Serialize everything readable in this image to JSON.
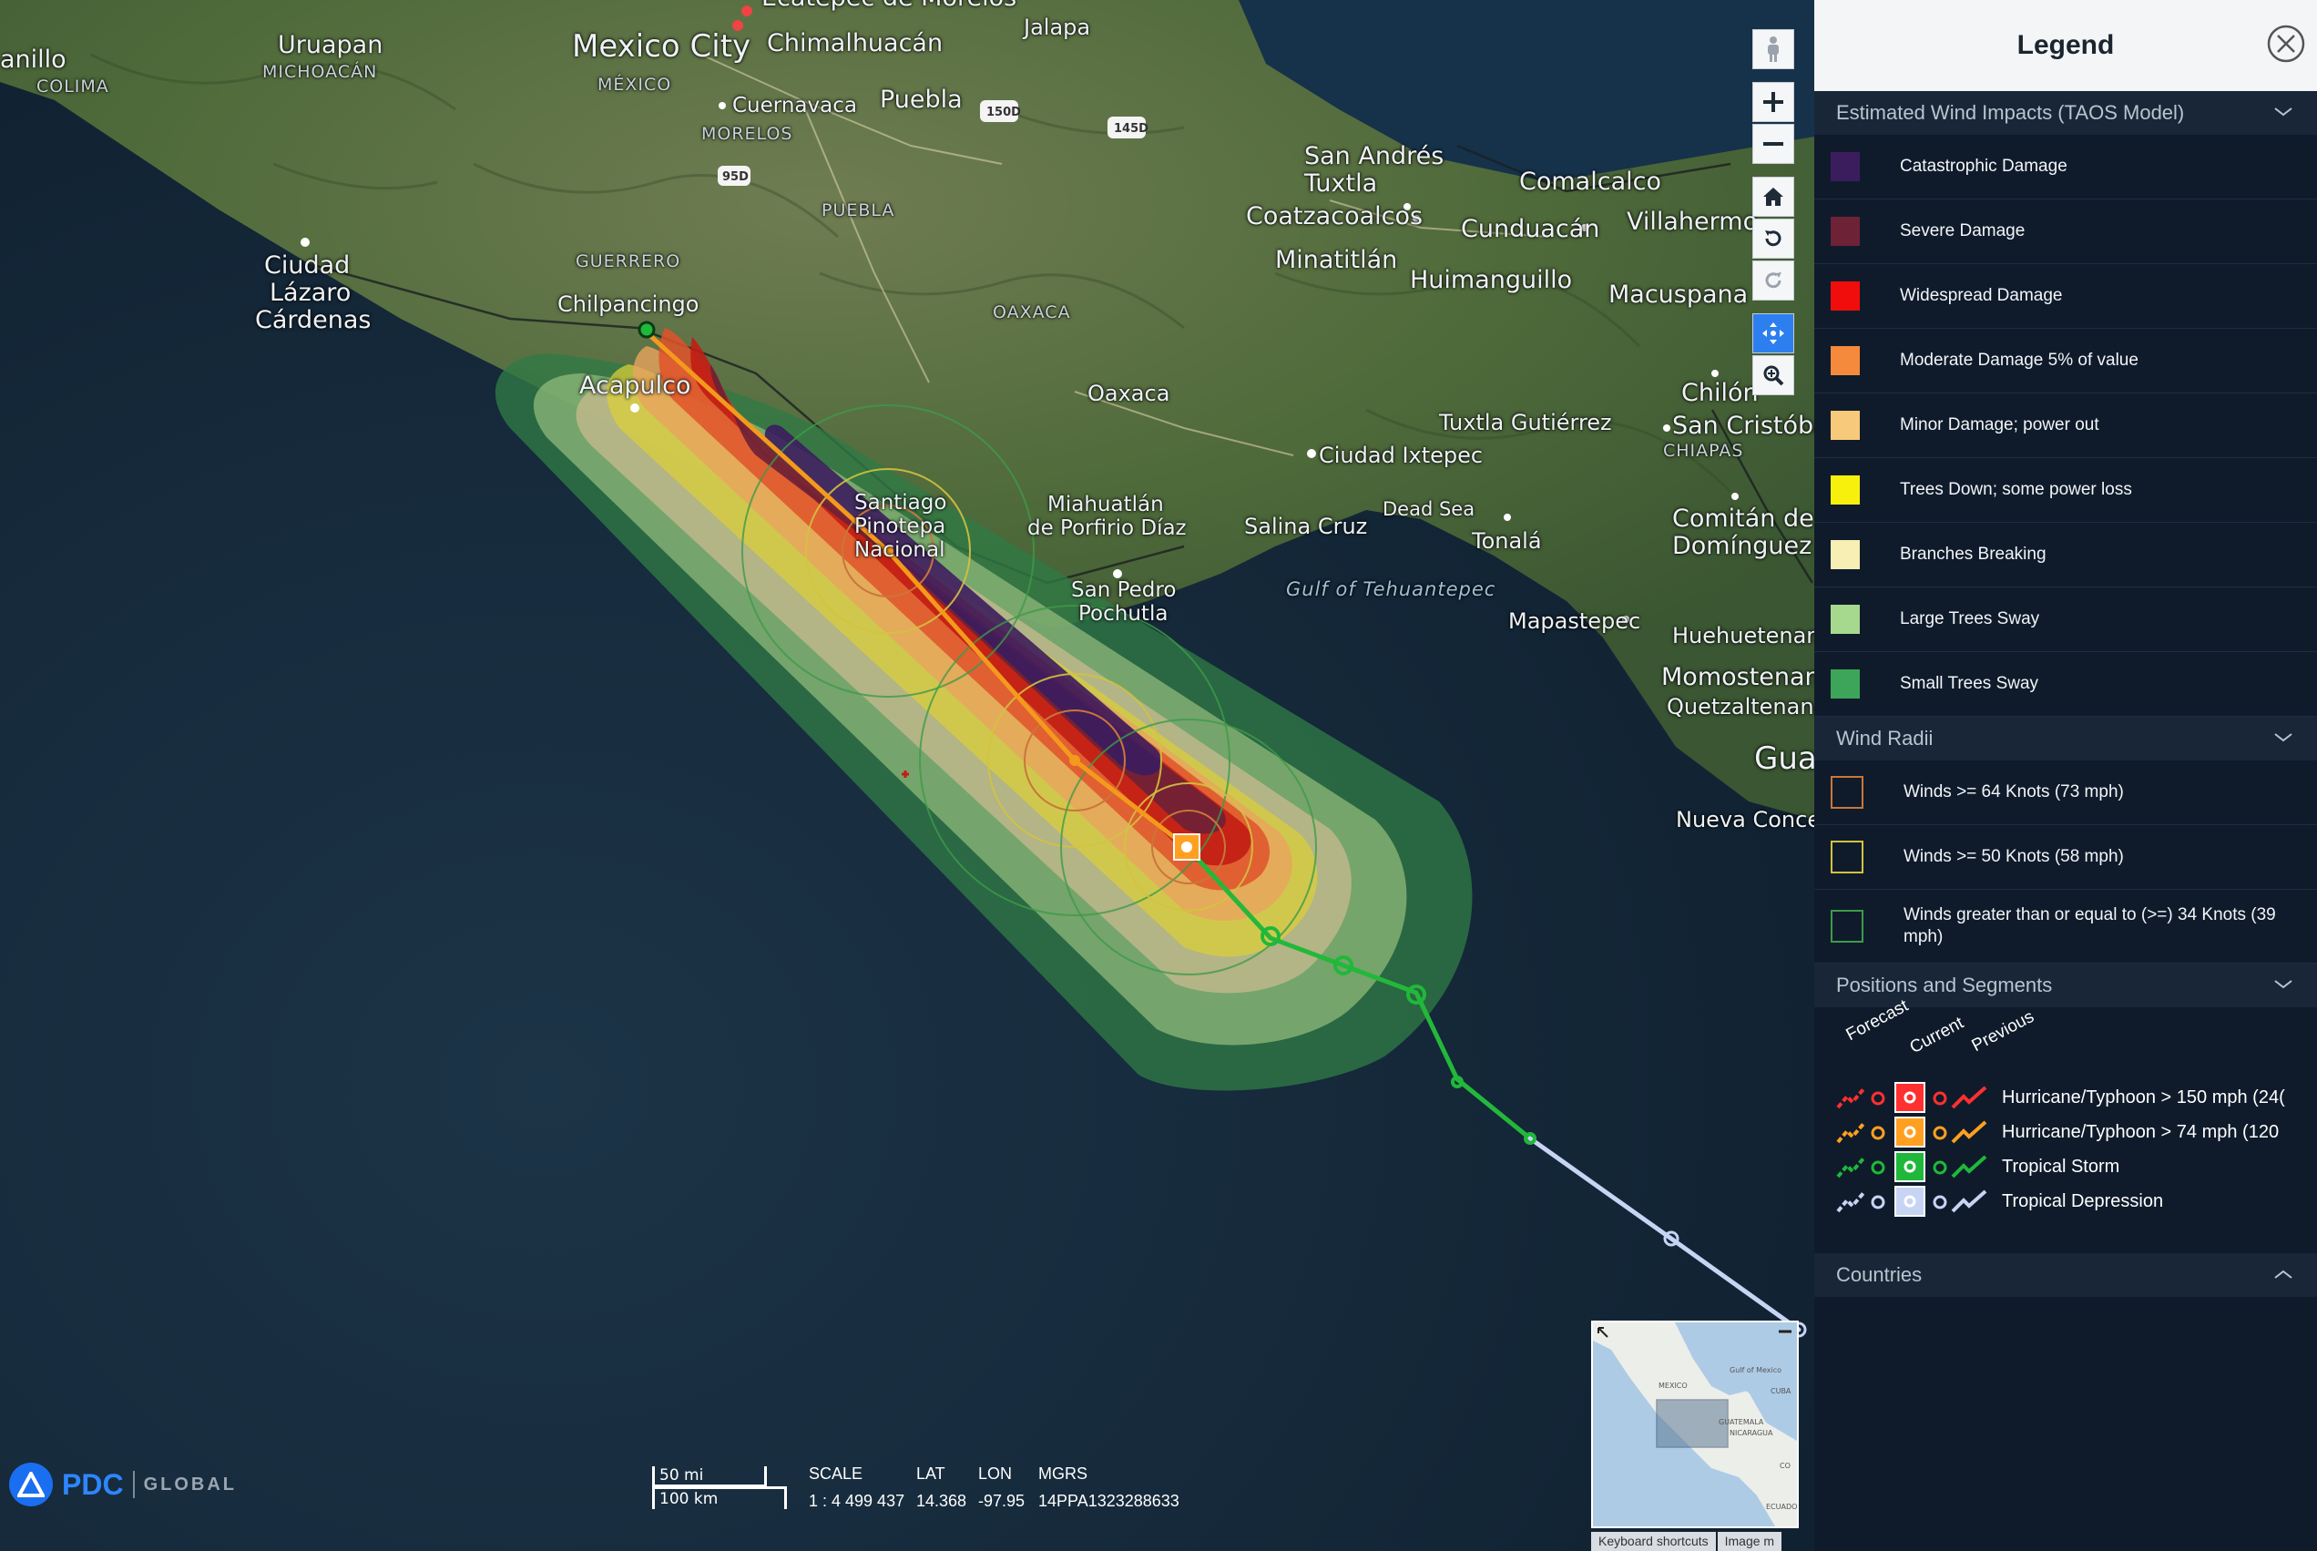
{
  "map": {
    "places": [
      {
        "name": "Uruapan",
        "cls": "city"
      },
      {
        "name": "MICHOACÁN",
        "cls": "state"
      },
      {
        "name": "anillo",
        "cls": "city"
      },
      {
        "name": "COLIMA",
        "cls": "state"
      },
      {
        "name": "Mexico City",
        "cls": "big"
      },
      {
        "name": "MÉXICO",
        "cls": "state"
      },
      {
        "name": "Chimalhuacán",
        "cls": "city"
      },
      {
        "name": "Ecatepec de Morelos",
        "cls": "city"
      },
      {
        "name": "Jalapa",
        "cls": "city"
      },
      {
        "name": "Cuernavaca",
        "cls": "city"
      },
      {
        "name": "Puebla",
        "cls": "city"
      },
      {
        "name": "MORELOS",
        "cls": "state"
      },
      {
        "name": "PUEBLA",
        "cls": "state"
      },
      {
        "name": "Ciudad",
        "cls": "city"
      },
      {
        "name": "Lázaro",
        "cls": "city"
      },
      {
        "name": "Cárdenas",
        "cls": "city"
      },
      {
        "name": "GUERRERO",
        "cls": "state"
      },
      {
        "name": "Chilpancingo",
        "cls": "city"
      },
      {
        "name": "Acapulco",
        "cls": "city"
      },
      {
        "name": "OAXACA",
        "cls": "state"
      },
      {
        "name": "Oaxaca",
        "cls": "city"
      },
      {
        "name": "Santiago",
        "cls": "city"
      },
      {
        "name": "Pinotepa",
        "cls": "city"
      },
      {
        "name": "Nacional",
        "cls": "city"
      },
      {
        "name": "Miahuatlán",
        "cls": "city"
      },
      {
        "name": "de Porfirio Díaz",
        "cls": "city"
      },
      {
        "name": "San Pedro",
        "cls": "city"
      },
      {
        "name": "Pochutla",
        "cls": "city"
      },
      {
        "name": "San Andrés",
        "cls": "city"
      },
      {
        "name": "Tuxtla",
        "cls": "city"
      },
      {
        "name": "Coatzacoalcos",
        "cls": "city"
      },
      {
        "name": "Minatitlán",
        "cls": "city"
      },
      {
        "name": "Comalcalco",
        "cls": "city"
      },
      {
        "name": "Cunduacán",
        "cls": "city"
      },
      {
        "name": "Villahermo",
        "cls": "city"
      },
      {
        "name": "Huimanguillo",
        "cls": "city"
      },
      {
        "name": "Macuspana",
        "cls": "city"
      },
      {
        "name": "Chilón",
        "cls": "city"
      },
      {
        "name": "Tuxtla Gutiérrez",
        "cls": "city"
      },
      {
        "name": "San Cristóbal",
        "cls": "city"
      },
      {
        "name": "CHIAPAS",
        "cls": "state"
      },
      {
        "name": "Ciudad Ixtepec",
        "cls": "city"
      },
      {
        "name": "Salina Cruz",
        "cls": "city"
      },
      {
        "name": "Dead Sea",
        "cls": "city"
      },
      {
        "name": "Tonalá",
        "cls": "city"
      },
      {
        "name": "Comitán de",
        "cls": "city"
      },
      {
        "name": "Domínguez",
        "cls": "city"
      },
      {
        "name": "Gulf of Tehuantepec",
        "cls": "water"
      },
      {
        "name": "Mapastepec",
        "cls": "city"
      },
      {
        "name": "Huehuetenang",
        "cls": "city"
      },
      {
        "name": "Momostenang",
        "cls": "city"
      },
      {
        "name": "Quetzaltenango",
        "cls": "city"
      },
      {
        "name": "Guat",
        "cls": "big"
      },
      {
        "name": "Nueva Concep",
        "cls": "city"
      }
    ],
    "highway_shields": [
      "150D",
      "145D",
      "95D"
    ]
  },
  "toolbar": {
    "tools": [
      {
        "icon": "street-view-icon",
        "label": "Street view"
      },
      {
        "icon": "zoom-in-icon",
        "label": "Zoom in"
      },
      {
        "icon": "zoom-out-icon",
        "label": "Zoom out"
      },
      {
        "icon": "home-icon",
        "label": "Home"
      },
      {
        "icon": "rotate-left-icon",
        "label": "Rotate left"
      },
      {
        "icon": "rotate-right-icon",
        "label": "Rotate right"
      },
      {
        "icon": "pan-icon",
        "label": "Pan"
      },
      {
        "icon": "zoom-box-icon",
        "label": "Zoom to box"
      }
    ]
  },
  "logo": {
    "brand": "PDC",
    "suffix": "GLOBAL"
  },
  "scale_bar": {
    "top": "50 mi",
    "bottom": "100 km"
  },
  "readout": {
    "scale_h": "SCALE",
    "scale_v": "1 : 4 499 437",
    "lat_h": "LAT",
    "lat_v": "14.368",
    "lon_h": "LON",
    "lon_v": "-97.95",
    "mgrs_h": "MGRS",
    "mgrs_v": "14PPA1323288633"
  },
  "inset": {
    "labels": [
      "MEXICO",
      "Gulf of Mexico",
      "CUBA",
      "GUATEMALA",
      "NICARAGUA",
      "ECUADOR",
      "CO"
    ],
    "footer": [
      "Keyboard shortcuts",
      "Image m"
    ]
  },
  "legend": {
    "title": "Legend",
    "wind_impacts": {
      "title": "Estimated Wind Impacts (TAOS Model)",
      "items": [
        {
          "label": "Catastrophic Damage",
          "color": "#3b1d5e"
        },
        {
          "label": "Severe Damage",
          "color": "#6e2236"
        },
        {
          "label": "Widespread Damage",
          "color": "#f20d0d"
        },
        {
          "label": "Moderate Damage 5% of value",
          "color": "#f58a3c"
        },
        {
          "label": "Minor Damage; power out",
          "color": "#f7c97a"
        },
        {
          "label": "Trees Down; some power loss",
          "color": "#f7f00d"
        },
        {
          "label": "Branches Breaking",
          "color": "#f7efb4"
        },
        {
          "label": "Large Trees Sway",
          "color": "#a6d88e"
        },
        {
          "label": "Small Trees Sway",
          "color": "#3da55a"
        }
      ]
    },
    "wind_radii": {
      "title": "Wind Radii",
      "items": [
        {
          "label": "Winds >= 64 Knots (73 mph)",
          "color": "#c9763a"
        },
        {
          "label": "Winds >= 50 Knots (58 mph)",
          "color": "#d3c240"
        },
        {
          "label": "Winds greater than or equal to (>=) 34 Knots (39 mph)",
          "color": "#3f9a4a"
        }
      ]
    },
    "positions": {
      "title": "Positions and Segments",
      "headers": [
        "Forecast",
        "Current",
        "Previous"
      ],
      "items": [
        {
          "label": "Hurricane/Typhoon > 150 mph (24(",
          "color": "#ff3030"
        },
        {
          "label": "Hurricane/Typhoon > 74 mph (120",
          "color": "#ffa020"
        },
        {
          "label": "Tropical Storm",
          "color": "#1fb83a"
        },
        {
          "label": "Tropical Depression",
          "color": "#c8d4f4"
        }
      ]
    },
    "countries": {
      "title": "Countries"
    }
  }
}
